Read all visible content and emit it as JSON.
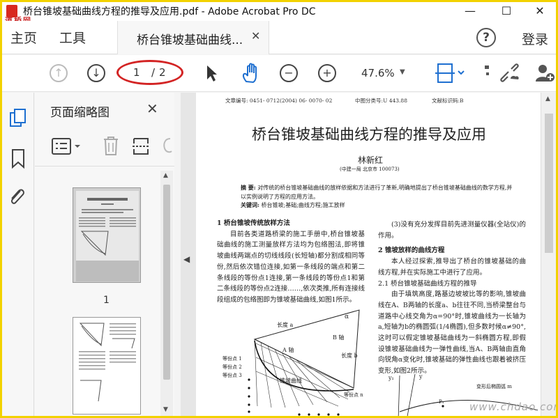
{
  "window": {
    "title": "桥台锥坡基础曲线方程的推导及应用.pdf - Adobe Acrobat Pro DC",
    "watermark_top": "道桥网",
    "min": "—",
    "max": "☐",
    "close": "✕"
  },
  "menubar": {
    "home": "主页",
    "tools": "工具",
    "doc_tab": "桥台锥坡基础曲线...",
    "doc_tab_close": "✕",
    "help": "?",
    "login": "登录"
  },
  "toolbar": {
    "page_current": "1",
    "page_separator": "/",
    "page_total": "2",
    "zoom": "47.6%",
    "icons": [
      "prev-page-icon",
      "next-page-icon",
      "select-arrow-icon",
      "hand-icon",
      "zoom-out-icon",
      "zoom-in-icon",
      "page-fit-icon",
      "comment-icon",
      "link-icon",
      "add-user-icon"
    ]
  },
  "panel": {
    "title": "页面缩略图",
    "close": "✕",
    "thumb_labels": [
      "1"
    ]
  },
  "document": {
    "meta_article_no": "文章编号: 0451- 0712(2004) 06- 0070- 02",
    "meta_class_no": "中图分类号:U 443.88",
    "meta_doc_code": "文献标识码:B",
    "title": "桥台锥坡基础曲线方程的推导及应用",
    "author": "林新红",
    "affiliation": "(中建一局   北京市   100073)",
    "abstract_label": "摘   要:",
    "abstract": "对传统的桥台锥坡基础曲线的放样依据和方法进行了革新,明确地提出了桥台锥坡基础曲线的数学方程,并以实例说明了方程的应用方法。",
    "keywords_label": "关键词:",
    "keywords": "桥台锥坡;基础;曲线方程;施工放样",
    "left_col": [
      {
        "type": "h",
        "text": "1   桥台锥坡传统放样方法"
      },
      {
        "type": "p",
        "text": "目前各类道路桥梁的施工手册中,桥台锥坡基础曲线的施工测量放样方法均为包络图法,即将锥坡曲线两端点的切线线段(长短轴)都分割成相同等份,然后依次错位连接,如第一条线段的端点和第二条线段的等份点1连接,第一条线段的等份点1和第二条线段的等份点2连接……,依次类推,所有连接线段组成的包络图即为锥坡基础曲线,如图1所示。"
      }
    ],
    "right_col": [
      {
        "type": "p",
        "text": "(3)没有充分发挥目前先进测量仪器(全站仪)的作用。"
      },
      {
        "type": "h",
        "text": "2   锥坡放样的曲线方程"
      },
      {
        "type": "p",
        "text": "本人经过探索,推导出了桥台的锥坡基础的曲线方程,并在实际施工中进行了应用。"
      },
      {
        "type": "h2",
        "text": "2.1   桥台锥坡基础曲线方程的推导"
      },
      {
        "type": "p",
        "text": "由于填筑高度,路基边坡坡比等的影响,锥坡曲线在A、B两轴的长度a、b往往不同,当桥梁整台与道路中心线交角为α=90°时,锥坡曲线为一长轴为a,短轴为b的椭圆弧(1/4椭圆),但多数时候α≠90°,这时可以假定锥坡基础曲线为一斜椭圆方程,即假设锥坡基础曲线为一弹性曲线,当A、B两轴由直角向锐角α变化时,锥坡基础的弹性曲线也跟着被挤压变形,如图2所示。"
      }
    ],
    "fig1_labels": {
      "length_a": "长度 a",
      "alpha": "α",
      "axis_b": "B 轴",
      "axis_a": "A 轴",
      "length_b": "长度 b",
      "divs": [
        "等份点 1",
        "等份点 2",
        "等份点 3"
      ],
      "curve": "锥坡曲线",
      "div_n": "等份点 n"
    },
    "fig2_labels": {
      "y1": "y₁",
      "y": "y",
      "ellipse": "变形后椭圆弧 m",
      "p1": "P₁"
    }
  },
  "watermark_bottom": "www.chdao.com"
}
